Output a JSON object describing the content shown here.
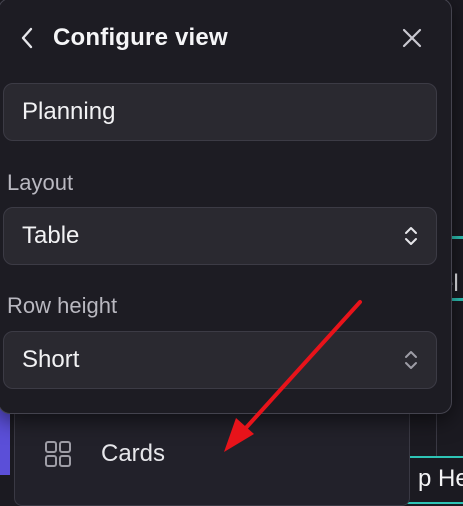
{
  "panel": {
    "title": "Configure view",
    "name_value": "Planning",
    "layout": {
      "label": "Layout",
      "selected": "Table"
    },
    "row_height": {
      "label": "Row height",
      "selected": "Short"
    }
  },
  "underlying_menu": {
    "cards_label": "Cards"
  },
  "background": {
    "fragment_1": "f",
    "fragment_2": "el",
    "tag_text": "p Hea"
  },
  "icons": {
    "back": "chevron-left-icon",
    "close": "close-icon",
    "select_arrows": "chevron-up-down-icon",
    "cards": "grid-icon",
    "annotation": "red-arrow"
  },
  "colors": {
    "panel_bg": "#1d1c23",
    "field_bg": "#2a2930",
    "accent_teal": "#2ec4b6",
    "accent_purple": "#5b4fd8",
    "annotation_red": "#e8131a"
  }
}
